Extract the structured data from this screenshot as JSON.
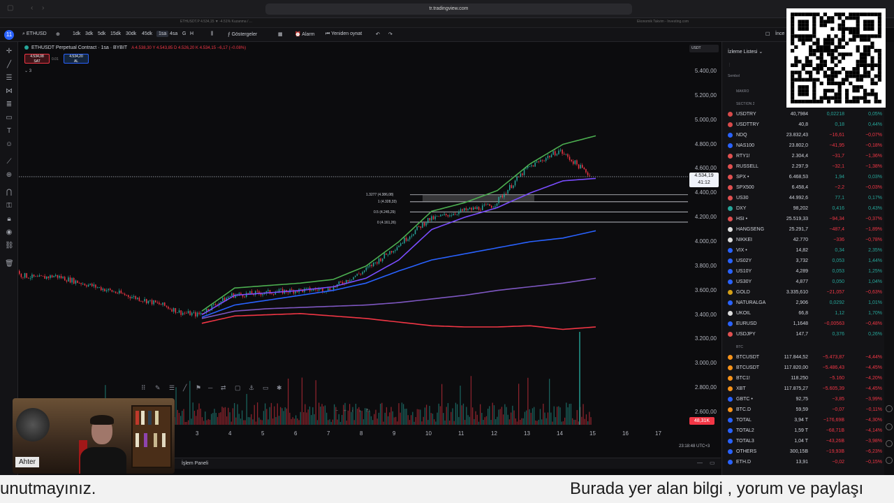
{
  "browser": {
    "url": "tr.tradingview.com"
  },
  "tabs": [
    "ETHUSDT.P 4.534,15 ▼ -4.51% Kuzanma / ...",
    "Ekonomik Takvim - Investing.com"
  ],
  "toolbar": {
    "avatar_badge": "11",
    "symbol": "ETHUSD",
    "timeframes": [
      "1dk",
      "3dk",
      "5dk",
      "15dk",
      "30dk",
      "45dk",
      "1sa",
      "4sa",
      "G",
      "H"
    ],
    "active_timeframe": "1sa",
    "indicators": "Göstergeler",
    "alarm": "Alarm",
    "replay": "Yeniden oynat",
    "right_label": "İnce"
  },
  "legend": {
    "title": "ETHUSDT Perpetual Contract · 1sa · BYBIT",
    "ohlc": "A 4.538,30  Y 4.543,85  D 4.526,20  K 4.534,15  −6,17 (−0.08%)",
    "sell_price": "4.534,08",
    "sell_label": "SAT",
    "spread": "0.01",
    "buy_price": "4.534,20",
    "buy_label": "AL",
    "indicator_count": "3"
  },
  "yaxis": {
    "currency": "USDT",
    "ticks": [
      "5.400,00",
      "5.200,00",
      "5.000,00",
      "4.800,00",
      "4.600,00",
      "4.400,00",
      "4.200,00",
      "4.000,00",
      "3.800,00",
      "3.600,00",
      "3.400,00",
      "3.200,00",
      "3.000,00",
      "2.800,00",
      "2.600,00"
    ],
    "current_price": "4.534,19",
    "countdown": "41:12",
    "volume": "48,31K"
  },
  "xaxis": {
    "ticks": [
      "3",
      "4",
      "5",
      "6",
      "7",
      "8",
      "9",
      "10",
      "11",
      "12",
      "13",
      "14",
      "15",
      "16",
      "17"
    ],
    "timestamp": "23:18:48 UTC+3"
  },
  "fib": {
    "levels": [
      "1.3277 (4.386,08)",
      "1 (4.328,33)",
      "0.5 (4.245,29)",
      "0 (4.161,26)"
    ]
  },
  "bottom_panel": {
    "label": "İşlem Paneli"
  },
  "webcam": {
    "name": "Ahter"
  },
  "watchlist": {
    "title": "İzleme Listesi",
    "column_symbol": "Sembol",
    "section_makro": "MAKRO",
    "section_2": "SECTION 2",
    "section_btc": "BTC",
    "rows": [
      {
        "sym": "USDTRY",
        "last": "40,7984",
        "chg": "0,02218",
        "pct": "0,05%",
        "c": "#d84a4a",
        "up": true
      },
      {
        "sym": "USDTTRY",
        "last": "40,8",
        "chg": "0,18",
        "pct": "0,44%",
        "c": "#d84a4a",
        "up": true
      },
      {
        "sym": "NDQ",
        "last": "23.832,43",
        "chg": "−16,61",
        "pct": "−0,07%",
        "c": "#2962ff",
        "up": false
      },
      {
        "sym": "NAS100",
        "last": "23.802,0",
        "chg": "−41,95",
        "pct": "−0,18%",
        "c": "#2962ff",
        "up": false
      },
      {
        "sym": "RTY1!",
        "last": "2.304,4",
        "chg": "−31,7",
        "pct": "−1,36%",
        "c": "#e05050",
        "up": false
      },
      {
        "sym": "RUSSELL",
        "last": "2.297,9",
        "chg": "−32,1",
        "pct": "−1,38%",
        "c": "#e05050",
        "up": false
      },
      {
        "sym": "SPX •",
        "last": "6.468,53",
        "chg": "1,94",
        "pct": "0,03%",
        "c": "#e05050",
        "up": true
      },
      {
        "sym": "SPX500",
        "last": "6.458,4",
        "chg": "−2,2",
        "pct": "−0,03%",
        "c": "#e05050",
        "up": false
      },
      {
        "sym": "US30",
        "last": "44.992,6",
        "chg": "77,1",
        "pct": "0,17%",
        "c": "#e05050",
        "up": true
      },
      {
        "sym": "DXY",
        "last": "98,202",
        "chg": "0,416",
        "pct": "0,43%",
        "c": "#26a69a",
        "up": true
      },
      {
        "sym": "HSI •",
        "last": "25.519,33",
        "chg": "−94,34",
        "pct": "−0,37%",
        "c": "#e05050",
        "up": false
      },
      {
        "sym": "HANGSENG",
        "last": "25.291,7",
        "chg": "−487,4",
        "pct": "−1,89%",
        "c": "#dddddd",
        "up": false
      },
      {
        "sym": "NIKKEI",
        "last": "42.770",
        "chg": "−336",
        "pct": "−0,78%",
        "c": "#dddddd",
        "up": false
      },
      {
        "sym": "VIX •",
        "last": "14,82",
        "chg": "0,34",
        "pct": "2,35%",
        "c": "#2962ff",
        "up": true
      },
      {
        "sym": "US02Y",
        "last": "3,732",
        "chg": "0,053",
        "pct": "1,44%",
        "c": "#2962ff",
        "up": true
      },
      {
        "sym": "US10Y",
        "last": "4,289",
        "chg": "0,053",
        "pct": "1,25%",
        "c": "#2962ff",
        "up": true
      },
      {
        "sym": "US30Y",
        "last": "4,877",
        "chg": "0,050",
        "pct": "1,04%",
        "c": "#2962ff",
        "up": true
      },
      {
        "sym": "GOLD",
        "last": "3.335,610",
        "chg": "−21,057",
        "pct": "−0,63%",
        "c": "#d4a017",
        "up": false
      },
      {
        "sym": "NATURALGA",
        "last": "2,906",
        "chg": "0,0292",
        "pct": "1,01%",
        "c": "#2962ff",
        "up": true
      },
      {
        "sym": "UKOIL",
        "last": "66,8",
        "chg": "1,12",
        "pct": "1,70%",
        "c": "#dddddd",
        "up": true
      },
      {
        "sym": "EURUSD",
        "last": "1,1648",
        "chg": "−0,00563",
        "pct": "−0,48%",
        "c": "#2962ff",
        "up": false
      },
      {
        "sym": "USDJPY",
        "last": "147,7",
        "chg": "0,376",
        "pct": "0,26%",
        "c": "#e05050",
        "up": true
      }
    ],
    "btc_rows": [
      {
        "sym": "BTCUSDT",
        "last": "117.844,52",
        "chg": "−5.473,87",
        "pct": "−4,44%",
        "c": "#f7931a",
        "up": false
      },
      {
        "sym": "BTCUSDT",
        "last": "117.820,00",
        "chg": "−5.486,43",
        "pct": "−4,45%",
        "c": "#f7931a",
        "up": false
      },
      {
        "sym": "BTC1!",
        "last": "118.250",
        "chg": "−5.160",
        "pct": "−4,20%",
        "c": "#f7931a",
        "up": false
      },
      {
        "sym": "XBT",
        "last": "117.875,27",
        "chg": "−5.605,39",
        "pct": "−4,45%",
        "c": "#f7931a",
        "up": false
      },
      {
        "sym": "GBTC •",
        "last": "92,75",
        "chg": "−3,85",
        "pct": "−3,99%",
        "c": "#2962ff",
        "up": false
      },
      {
        "sym": "BTC.D",
        "last": "59,59",
        "chg": "−0,07",
        "pct": "−0,11%",
        "c": "#f7931a",
        "up": false
      },
      {
        "sym": "TOTAL",
        "last": "3,94 T",
        "chg": "−176,69B",
        "pct": "−4,30%",
        "c": "#2962ff",
        "up": false
      },
      {
        "sym": "TOTAL2",
        "last": "1,59 T",
        "chg": "−68,71B",
        "pct": "−4,14%",
        "c": "#2962ff",
        "up": false
      },
      {
        "sym": "TOTAL3",
        "last": "1,04 T",
        "chg": "−43,26B",
        "pct": "−3,98%",
        "c": "#2962ff",
        "up": false
      },
      {
        "sym": "OTHERS",
        "last": "300,15B",
        "chg": "−19,93B",
        "pct": "−6,23%",
        "c": "#2962ff",
        "up": false
      },
      {
        "sym": "ETH.D",
        "last": "13,91",
        "chg": "−0,02",
        "pct": "−0,15%",
        "c": "#2962ff",
        "up": false
      }
    ]
  },
  "subtitle": {
    "left": "unutmayınız.",
    "right": "Burada yer alan bilgi , yorum ve paylaşı"
  },
  "chart_data": {
    "type": "candlestick",
    "title": "ETHUSDT Perpetual Contract · 1sa · BYBIT",
    "ylim": [
      2500,
      5500
    ],
    "x": [
      "3",
      "4",
      "5",
      "6",
      "7",
      "8",
      "9",
      "10",
      "11",
      "12",
      "13",
      "14",
      "15"
    ],
    "close_approx": [
      3400,
      3560,
      3580,
      3600,
      3610,
      3750,
      3950,
      4180,
      4250,
      4300,
      4600,
      4750,
      4534
    ],
    "series": [
      {
        "color": "#4caf50",
        "values": [
          3430,
          3620,
          3640,
          3660,
          3690,
          3800,
          4000,
          4250,
          4320,
          4420,
          4640,
          4800,
          4870
        ]
      },
      {
        "color": "#7a4dff",
        "values": [
          3400,
          3560,
          3580,
          3600,
          3630,
          3700,
          3850,
          4100,
          4200,
          4280,
          4400,
          4500,
          4520
        ]
      },
      {
        "color": "#2962ff",
        "values": [
          3380,
          3480,
          3520,
          3560,
          3600,
          3660,
          3760,
          3850,
          3900,
          3950,
          4000,
          4030,
          4090
        ]
      },
      {
        "color": "#7e57c2",
        "values": [
          3370,
          3430,
          3450,
          3460,
          3470,
          3480,
          3500,
          3530,
          3560,
          3600,
          3630,
          3660,
          3700
        ]
      },
      {
        "color": "#f23645",
        "values": [
          3330,
          3390,
          3400,
          3410,
          3390,
          3370,
          3340,
          3310,
          3300,
          3300,
          3310,
          3280,
          3300
        ]
      }
    ]
  }
}
